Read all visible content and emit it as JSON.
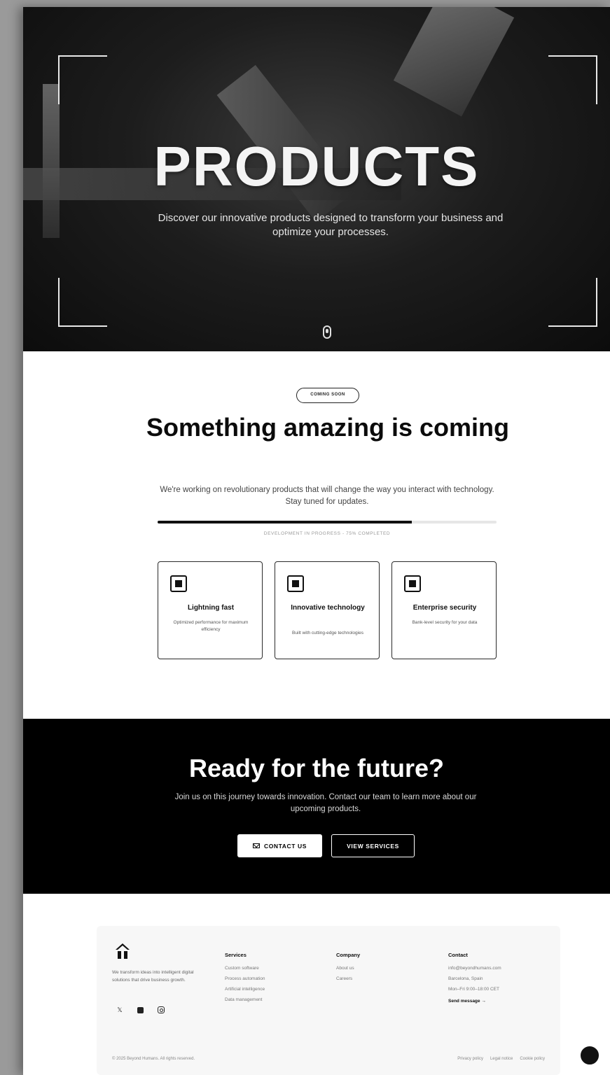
{
  "hero": {
    "title": "PRODUCTS",
    "subtitle": "Discover our innovative products designed to transform your business and optimize your processes."
  },
  "coming_soon": {
    "badge": "COMING SOON",
    "title": "Something amazing is coming",
    "text": "We're working on revolutionary products that will change the way you interact with technology. Stay tuned for updates.",
    "progress_label": "DEVELOPMENT IN PROGRESS - 75% COMPLETED",
    "progress_percent": 75
  },
  "features": [
    {
      "title": "Lightning fast",
      "description": "Optimized performance for maximum efficiency"
    },
    {
      "title": "Innovative technology",
      "description": "Built with cutting-edge technologies"
    },
    {
      "title": "Enterprise security",
      "description": "Bank-level security for your data"
    }
  ],
  "cta": {
    "title": "Ready for the future?",
    "text": "Join us on this journey towards innovation. Contact our team to learn more about our upcoming products.",
    "contact_label": "CONTACT US",
    "services_label": "VIEW SERVICES"
  },
  "footer": {
    "about": "We transform ideas into intelligent digital solutions that drive business growth.",
    "services": {
      "heading": "Services",
      "items": [
        "Custom software",
        "Process automation",
        "Artificial intelligence",
        "Data management"
      ]
    },
    "company": {
      "heading": "Company",
      "items": [
        "About us",
        "Careers"
      ]
    },
    "contact": {
      "heading": "Contact",
      "items": [
        "info@beyondhumans.com",
        "Barcelona, Spain",
        "Mon–Fri 9:00–18:00 CET"
      ],
      "link": "Send message →"
    },
    "copyright": "© 2025 Beyond Humans. All rights reserved.",
    "legal": [
      "Privacy policy",
      "Legal notice",
      "Cookie policy"
    ]
  },
  "icons": [
    "scroll-mouse-icon",
    "chip-icon",
    "mail-icon",
    "x-icon",
    "linkedin-icon",
    "instagram-icon",
    "logo-icon",
    "chat-icon"
  ]
}
